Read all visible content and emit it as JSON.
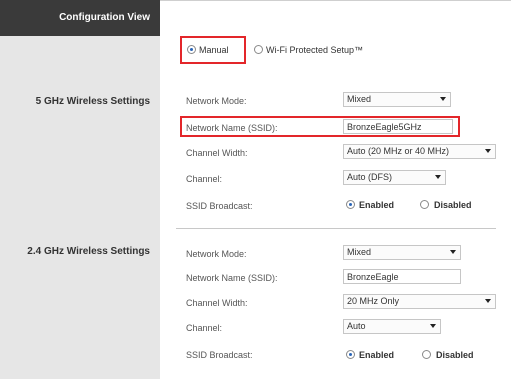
{
  "sidebar": {
    "header_title": "Configuration View",
    "section_5ghz": "5 GHz Wireless Settings",
    "section_24ghz": "2.4 GHz Wireless Settings"
  },
  "setup_mode": {
    "manual_label": "Manual",
    "wps_label": "Wi-Fi Protected Setup™",
    "selected": "Manual"
  },
  "wireless_5ghz": {
    "network_mode_label": "Network Mode:",
    "network_mode_value": "Mixed",
    "network_name_label": "Network Name (SSID):",
    "network_name_value": "BronzeEagle5GHz",
    "channel_width_label": "Channel Width:",
    "channel_width_value": "Auto (20 MHz or 40 MHz)",
    "channel_label": "Channel:",
    "channel_value": "Auto (DFS)",
    "ssid_broadcast_label": "SSID Broadcast:",
    "enabled_label": "Enabled",
    "disabled_label": "Disabled",
    "ssid_broadcast_selected": "Enabled"
  },
  "wireless_24ghz": {
    "network_mode_label": "Network Mode:",
    "network_mode_value": "Mixed",
    "network_name_label": "Network Name (SSID):",
    "network_name_value": "BronzeEagle",
    "channel_width_label": "Channel Width:",
    "channel_width_value": "20 MHz Only",
    "channel_label": "Channel:",
    "channel_value": "Auto",
    "ssid_broadcast_label": "SSID Broadcast:",
    "enabled_label": "Enabled",
    "disabled_label": "Disabled",
    "ssid_broadcast_selected": "Enabled"
  },
  "colors": {
    "highlight": "#e3262a",
    "sidebar_header_bg": "#3a3a3a",
    "sidebar_bg": "#e6e6e6",
    "radio_dot": "#2a66b8"
  }
}
